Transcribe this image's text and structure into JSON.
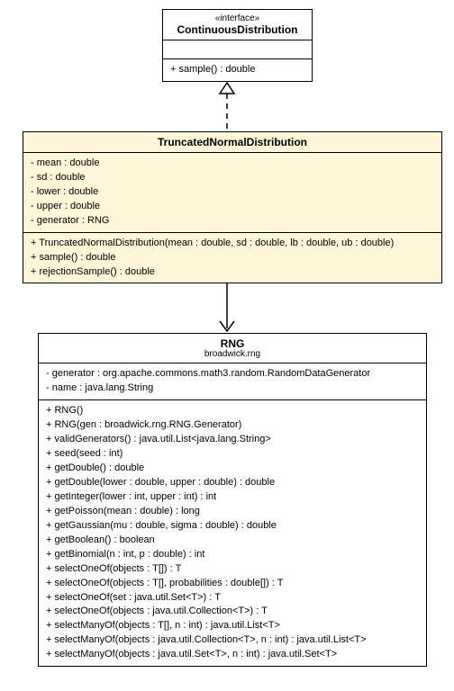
{
  "interface": {
    "stereotype": "«interface»",
    "name": "ContinuousDistribution",
    "methods": [
      "+ sample() : double"
    ]
  },
  "truncated": {
    "name": "TruncatedNormalDistribution",
    "fields": [
      "- mean : double",
      "- sd : double",
      "- lower : double",
      "- upper : double",
      "- generator : RNG"
    ],
    "methods": [
      "+ TruncatedNormalDistribution(mean : double, sd : double, lb : double, ub : double)",
      "+ sample() : double",
      "+ rejectionSample() : double"
    ]
  },
  "rng": {
    "name": "RNG",
    "package": "broadwick.rng",
    "fields": [
      "- generator : org.apache.commons.math3.random.RandomDataGenerator",
      "- name : java.lang.String"
    ],
    "methods": [
      "+ RNG()",
      "+ RNG(gen : broadwick.rng.RNG.Generator)",
      "+ validGenerators() : java.util.List<java.lang.String>",
      "+ seed(seed : int)",
      "+ getDouble() : double",
      "+ getDouble(lower : double, upper : double) : double",
      "+ getInteger(lower : int, upper : int) : int",
      "+ getPoisson(mean : double) : long",
      "+ getGaussian(mu : double, sigma : double) : double",
      "+ getBoolean() : boolean",
      "+ getBinomial(n : int, p : double) : int",
      "+ selectOneOf(objects : T[]) : T",
      "+ selectOneOf(objects : T[], probabilities : double[]) : T",
      "+ selectOneOf(set : java.util.Set<T>) : T",
      "+ selectOneOf(objects : java.util.Collection<T>) : T",
      "+ selectManyOf(objects : T[], n : int) : java.util.List<T>",
      "+ selectManyOf(objects : java.util.Collection<T>, n : int) : java.util.List<T>",
      "+ selectManyOf(objects : java.util.Set<T>, n : int) : java.util.Set<T>"
    ]
  }
}
